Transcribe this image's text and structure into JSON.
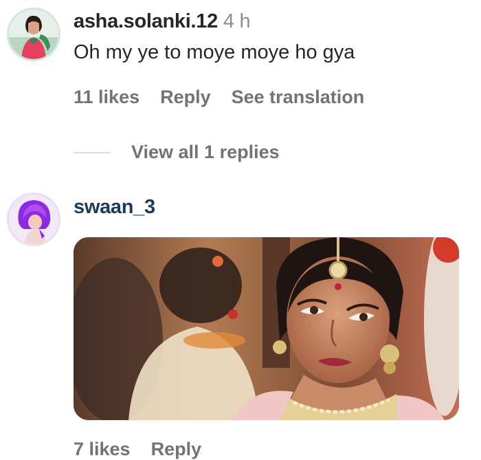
{
  "comments": [
    {
      "username": "asha.solanki.12",
      "time": "4 h",
      "text": "Oh my ye to moye moye ho gya",
      "likes": "11 likes",
      "reply": "Reply",
      "translate": "See translation",
      "view_replies": "View all 1 replies"
    },
    {
      "username": "swaan_3",
      "likes": "7 likes",
      "reply": "Reply"
    }
  ],
  "colors": {
    "username_first": "#262626",
    "username_second": "#1b3a5c",
    "muted": "#737373",
    "avatar_ring_first": "#c9e6d4",
    "avatar_bg_second": "#e9d8f5"
  }
}
